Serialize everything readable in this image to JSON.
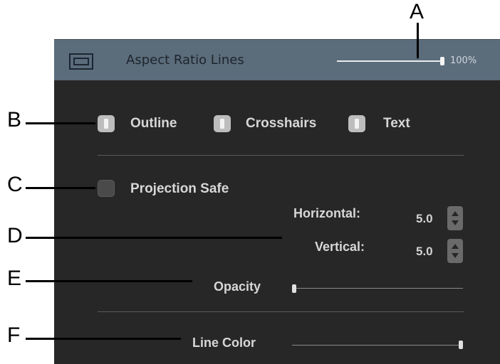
{
  "header": {
    "title": "Aspect Ratio Lines",
    "zoom_label": "100%",
    "zoom_value": 1.0
  },
  "checkboxes": [
    {
      "label": "Outline",
      "checked": true
    },
    {
      "label": "Crosshairs",
      "checked": true
    },
    {
      "label": "Text",
      "checked": true
    }
  ],
  "projection_safe": {
    "label": "Projection Safe",
    "checked": false
  },
  "horizontal": {
    "label": "Horizontal:",
    "value": "5.0"
  },
  "vertical": {
    "label": "Vertical:",
    "value": "5.0"
  },
  "opacity": {
    "label": "Opacity",
    "value": 0.0
  },
  "line_color": {
    "label": "Line Color",
    "value": 1.0
  },
  "callouts": [
    "A",
    "B",
    "C",
    "D",
    "E",
    "F"
  ],
  "colors": {
    "header": "#5b6c7b",
    "panel": "#272727"
  }
}
